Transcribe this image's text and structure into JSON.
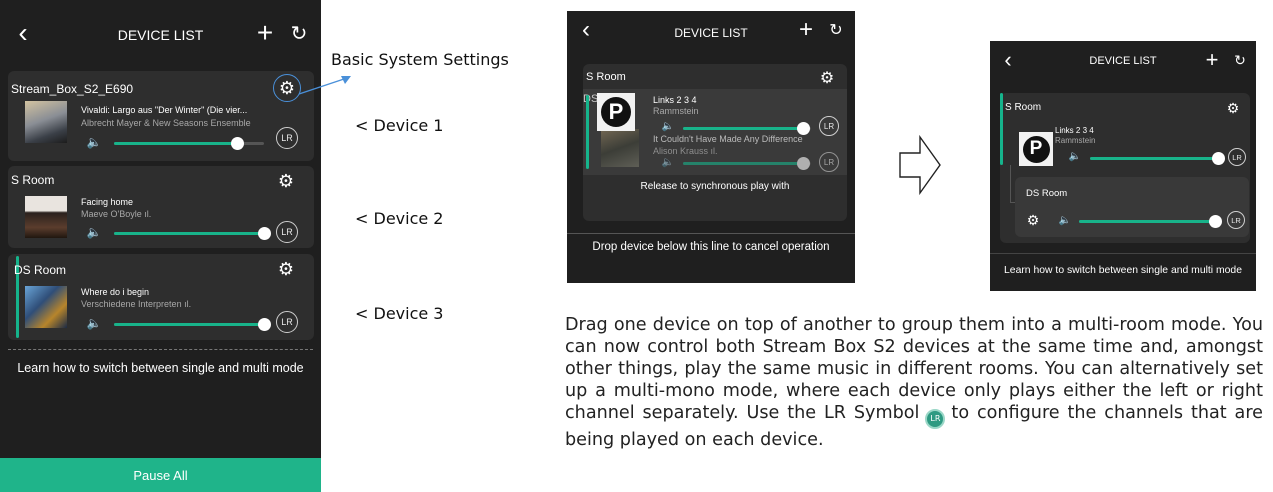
{
  "screen1": {
    "title": "DEVICE LIST",
    "devices": [
      {
        "name": "Stream_Box_S2_E690",
        "track": "Vivaldi: Largo aus \"Der Winter\" (Die vier...",
        "artist": "Albrecht Mayer & New Seasons Ensemble",
        "volume": 0.82
      },
      {
        "name": "S Room",
        "track": "Facing home",
        "artist": "Maeve O'Boyle ıl.",
        "volume": 1.0
      },
      {
        "name": "DS Room",
        "track": "Where do i begin",
        "artist": "Verschiedene Interpreten ıl.",
        "volume": 1.0
      }
    ],
    "learn": "Learn how to switch between single and multi mode",
    "pause_all": "Pause All",
    "lr_label": "LR"
  },
  "annotations": {
    "settings": "Basic System Settings",
    "device1": "< Device 1",
    "device2": "< Device 2",
    "device3": "< Device 3"
  },
  "screen2": {
    "title": "DEVICE LIST",
    "room": "S Room",
    "ghost_room": "DS Room",
    "track": "Links 2 3 4",
    "artist": "Rammstein",
    "ghost_track": "It Couldn't Have Made Any Difference",
    "ghost_artist": "Alison Krauss ıl.",
    "release": "Release to synchronous play with",
    "drop": "Drop device below this line to cancel operation",
    "volume": 0.94,
    "ghost_volume": 0.94
  },
  "screen3": {
    "title": "DEVICE LIST",
    "room": "S Room",
    "track": "Links 2 3 4",
    "artist": "Rammstein",
    "sub_room": "DS Room",
    "learn": "Learn how to switch between single and multi mode",
    "volume": 1.0,
    "sub_volume": 1.0
  },
  "description": {
    "text_before": "Drag one device on top of another to group them into a multi-room mode. You can now control both Stream Box S2 devices at the same time and, amongst other things, play the same music in different rooms. You can alternatively set up a multi-mono mode, where each device only plays either the left or right channel separately. Use the LR Symbol",
    "text_after": "to configure the channels that are being played on each device."
  },
  "colors": {
    "accent": "#16b48c",
    "pause_bar": "#1fb48a",
    "callout": "#4a90d9"
  },
  "icons": [
    "back-icon",
    "plus-icon",
    "refresh-icon",
    "gear-icon",
    "speaker-icon",
    "lr-icon",
    "right-arrow-icon"
  ]
}
